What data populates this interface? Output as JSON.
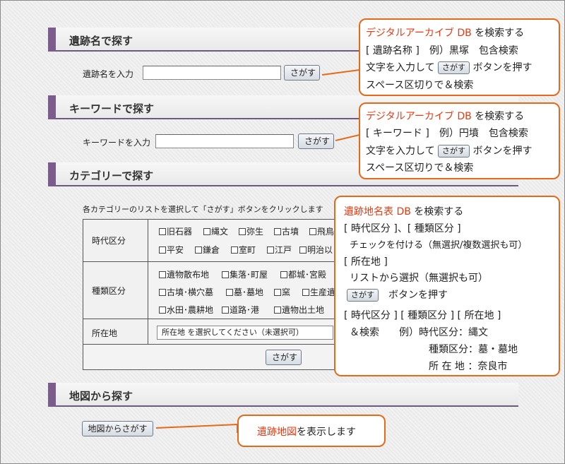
{
  "sections": {
    "name": {
      "title": "遺跡名で探す",
      "label": "遺跡名を入力",
      "button": "さがす"
    },
    "keyword": {
      "title": "キーワードで探す",
      "label": "キーワードを入力",
      "button": "さがす"
    },
    "category": {
      "title": "カテゴリーで探す",
      "instruction": "各カテゴリーのリストを選択して「さがす」ボタンをクリックします",
      "era_label": "時代区分",
      "era_items": [
        "旧石器",
        "縄文",
        "弥生",
        "古墳",
        "飛鳥",
        "平安",
        "鎌倉",
        "室町",
        "江戸",
        "明治以"
      ],
      "type_label": "種類区分",
      "type_items": [
        "遺物散布地",
        "集落･町屋",
        "都城･宮殿",
        "古墳･横穴墓",
        "墓･墓地",
        "窯",
        "生産遺",
        "水田･農耕地",
        "道路･港",
        "遺物出土地"
      ],
      "location_label": "所在地",
      "location_select": "所在地 を選択してください（未選択可）",
      "button": "さがす"
    },
    "map": {
      "title": "地図から探す",
      "button": "地図からさがす"
    }
  },
  "callouts": {
    "name": {
      "l1_red": "デジタルアーカイブ DB",
      "l1_rest": " を検索する",
      "l2": "[ 遺跡名称 ]　例）黒塚　包含検索",
      "l3_pre": "文字を入力して",
      "l3_btn": "さがす",
      "l3_post": "ボタンを押す",
      "l4": "スペース区切りで＆検索"
    },
    "keyword": {
      "l1_red": "デジタルアーカイブ DB",
      "l1_rest": " を検索する",
      "l2": "[ キーワード ]　例）円墳　包含検索",
      "l3_pre": "文字を入力して",
      "l3_btn": "さがす",
      "l3_post": "ボタンを押す",
      "l4": "スペース区切りで＆検索"
    },
    "category": {
      "l1_red": "遺跡地名表 DB",
      "l1_rest": " を検索する",
      "l2": "[ 時代区分 ]、[ 種類区分 ]",
      "l3": "チェックを付ける（無選択/複数選択も可）",
      "l4": "[ 所在地 ]",
      "l5": "リストから選択（無選択も可）",
      "l6_btn": "さがす",
      "l6_post": "ボタンを押す",
      "l7": "[ 時代区分 ] [ 種類区分 ] [ 所在地 ]",
      "l8": "＆検索　　例）時代区分：縄文",
      "l9": "種類区分：墓・墓地",
      "l10": "所 在 地 ：奈良市"
    },
    "map": {
      "red": "遺跡地図",
      "rest": "を表示します"
    }
  },
  "colors": {
    "accent_bar": "#7a5d8a",
    "callout_border": "#e26a19",
    "callout_red": "#e53a14"
  }
}
